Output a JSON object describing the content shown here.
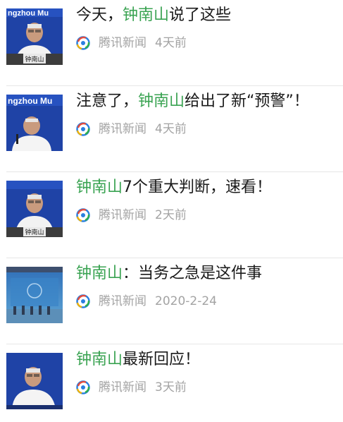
{
  "articles": [
    {
      "title_pre": "今天，",
      "title_hl": "钟南山",
      "title_post": "说了这些",
      "source": "腾讯新闻",
      "time": "4天前",
      "thumb_banner": "ngzhou Mu",
      "thumb_plate": "钟南山"
    },
    {
      "title_pre": "注意了，",
      "title_hl": "钟南山",
      "title_post": "给出了新“预警”！",
      "source": "腾讯新闻",
      "time": "4天前",
      "thumb_banner": "ngzhou Mu",
      "thumb_plate": ""
    },
    {
      "title_pre": "",
      "title_hl": "钟南山",
      "title_post": "7个重大判断，速看！",
      "source": "腾讯新闻",
      "time": "2天前",
      "thumb_banner": "",
      "thumb_plate": "钟南山"
    },
    {
      "title_pre": "",
      "title_hl": "钟南山",
      "title_post": "：当务之急是这件事",
      "source": "腾讯新闻",
      "time": "2020-2-24",
      "thumb_banner": "",
      "thumb_plate": ""
    },
    {
      "title_pre": "",
      "title_hl": "钟南山",
      "title_post": "最新回应！",
      "source": "腾讯新闻",
      "time": "3天前",
      "thumb_banner": "",
      "thumb_plate": ""
    }
  ],
  "colors": {
    "highlight": "#3aa352",
    "meta": "#a3a3a3",
    "title": "#1a1a1a"
  },
  "icons": {
    "source": "tencent-news-icon"
  }
}
